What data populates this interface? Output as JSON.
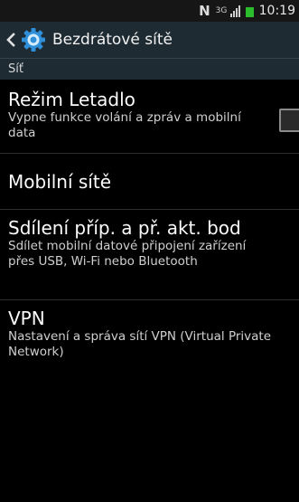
{
  "status_bar": {
    "nfc_glyph": "N",
    "network_type": "3G",
    "time": "10:19"
  },
  "action_bar": {
    "title": "Bezdrátové sítě"
  },
  "section": {
    "header": "Síť"
  },
  "items": [
    {
      "title": "Režim Letadlo",
      "summary": "Vypne funkce volání a zpráv a mobilní data",
      "checked": false
    },
    {
      "title": "Mobilní sítě"
    },
    {
      "title": "Sdílení příp. a př. akt. bod",
      "summary": "Sdílet mobilní datové připojení zařízení přes USB, Wi-Fi nebo Bluetooth"
    },
    {
      "title": "VPN",
      "summary": "Nastavení a správa sítí VPN (Virtual Private Network)"
    }
  ],
  "colors": {
    "action_bar": "#1e2b33",
    "background": "#000000",
    "battery": "#2bbd2b",
    "settings_icon": "#2f8fd8"
  }
}
